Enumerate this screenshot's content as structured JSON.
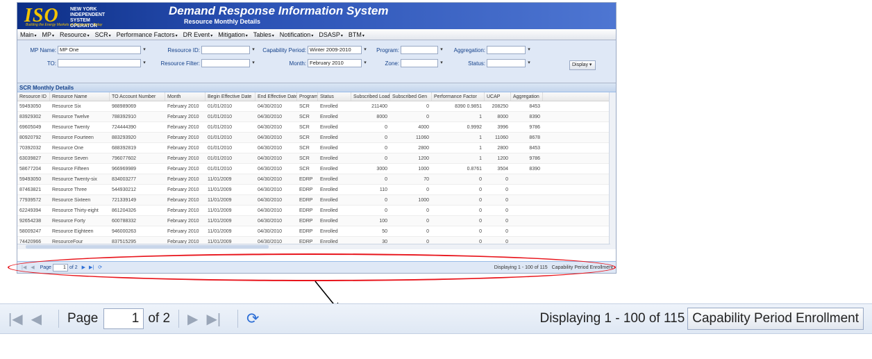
{
  "app": {
    "logo_text": "ISO",
    "logo_org": "NEW YORK INDEPENDENT SYSTEM OPERATOR",
    "logo_tagline": "Building the Energy Markets of Tomorrow... Today",
    "title": "Demand Response Information System",
    "subtitle": "Resource Monthly Details"
  },
  "menu": [
    "Main",
    "MP",
    "Resource",
    "SCR",
    "Performance Factors",
    "DR Event",
    "Mitigation",
    "Tables",
    "Notification",
    "DSASP",
    "BTM"
  ],
  "filters": {
    "mp_name_label": "MP Name:",
    "mp_name_value": "MP One",
    "to_label": "TO:",
    "to_value": "",
    "resource_id_label": "Resource ID:",
    "resource_id_value": "",
    "resource_filter_label": "Resource Filter:",
    "resource_filter_value": "",
    "capability_period_label": "Capability Period:",
    "capability_period_value": "Winter 2009-2010",
    "month_label": "Month:",
    "month_value": "February 2010",
    "program_label": "Program:",
    "program_value": "",
    "zone_label": "Zone:",
    "zone_value": "",
    "aggregation_label": "Aggregation:",
    "aggregation_value": "",
    "status_label": "Status:",
    "status_value": "",
    "display_button": "Display"
  },
  "panel_title": "SCR Monthly Details",
  "grid": {
    "columns": [
      "Resource ID",
      "Resource Name",
      "TO Account Number",
      "Month",
      "Begin Effective Date",
      "End Effective Date",
      "Program",
      "Status",
      "Subscribed Load",
      "Subscribed Gen",
      "Performance Factor",
      "UCAP",
      "Aggregation"
    ],
    "rows": [
      [
        "59493050",
        "Resource Six",
        "988989069",
        "February 2010",
        "01/01/2010",
        "04/30/2010",
        "SCR",
        "Enrolled",
        "211400",
        "0",
        "8390 0.9851",
        "208250",
        "8453"
      ],
      [
        "83929302",
        "Resource Twelve",
        "788392910",
        "February 2010",
        "01/01/2010",
        "04/30/2010",
        "SCR",
        "Enrolled",
        "8000",
        "0",
        "1",
        "8000",
        "8390"
      ],
      [
        "69605049",
        "Resource Twenty",
        "724444390",
        "February 2010",
        "01/01/2010",
        "04/30/2010",
        "SCR",
        "Enrolled",
        "0",
        "4000",
        "0.9992",
        "3996",
        "9786"
      ],
      [
        "80920792",
        "Resource Fourteen",
        "883293920",
        "February 2010",
        "01/01/2010",
        "04/30/2010",
        "SCR",
        "Enrolled",
        "0",
        "11060",
        "1",
        "11060",
        "8678"
      ],
      [
        "70392032",
        "Resource One",
        "688392819",
        "February 2010",
        "01/01/2010",
        "04/30/2010",
        "SCR",
        "Enrolled",
        "0",
        "2800",
        "1",
        "2800",
        "8453"
      ],
      [
        "63039827",
        "Resource Seven",
        "796077602",
        "February 2010",
        "01/01/2010",
        "04/30/2010",
        "SCR",
        "Enrolled",
        "0",
        "1200",
        "1",
        "1200",
        "9786"
      ],
      [
        "58677204",
        "Resource Fifteen",
        "966969989",
        "February 2010",
        "01/01/2010",
        "04/30/2010",
        "SCR",
        "Enrolled",
        "3000",
        "1000",
        "0.8761",
        "3504",
        "8390"
      ],
      [
        "59493050",
        "Resource Twenty-six",
        "834003277",
        "February 2010",
        "11/01/2009",
        "04/30/2010",
        "EDRP",
        "Enrolled",
        "0",
        "70",
        "0",
        "0",
        ""
      ],
      [
        "87463821",
        "Resource Three",
        "544930212",
        "February 2010",
        "11/01/2009",
        "04/30/2010",
        "EDRP",
        "Enrolled",
        "110",
        "0",
        "0",
        "0",
        ""
      ],
      [
        "77939572",
        "Resource Sixteen",
        "721339149",
        "February 2010",
        "11/01/2009",
        "04/30/2010",
        "EDRP",
        "Enrolled",
        "0",
        "1000",
        "0",
        "0",
        ""
      ],
      [
        "62249394",
        "Resource Thirty-eight",
        "861204326",
        "February 2010",
        "11/01/2009",
        "04/30/2010",
        "EDRP",
        "Enrolled",
        "0",
        "0",
        "0",
        "0",
        ""
      ],
      [
        "92654238",
        "Resource Forty",
        "600788332",
        "February 2010",
        "11/01/2009",
        "04/30/2010",
        "EDRP",
        "Enrolled",
        "100",
        "0",
        "0",
        "0",
        ""
      ],
      [
        "58009247",
        "Resource Eighteen",
        "946000263",
        "February 2010",
        "11/01/2009",
        "04/30/2010",
        "EDRP",
        "Enrolled",
        "50",
        "0",
        "0",
        "0",
        ""
      ],
      [
        "74420966",
        "ResourceFour",
        "837515295",
        "February 2010",
        "11/01/2009",
        "04/30/2010",
        "EDRP",
        "Enrolled",
        "30",
        "0",
        "0",
        "0",
        ""
      ]
    ]
  },
  "small_pager": {
    "page_label": "Page",
    "page_value": "1",
    "of_label": "of 2",
    "status": "Displaying 1 - 100 of 115",
    "button": "Capability Period Enrollment"
  },
  "pager": {
    "page_label": "Page",
    "page_value": "1",
    "of_label": "of 2",
    "status": "Displaying 1 - 100 of 115",
    "enroll_button": "Capability Period Enrollment"
  },
  "colors": {
    "banner": "#0c2e86",
    "accent": "#e8141b",
    "logo": "#f2c200"
  }
}
